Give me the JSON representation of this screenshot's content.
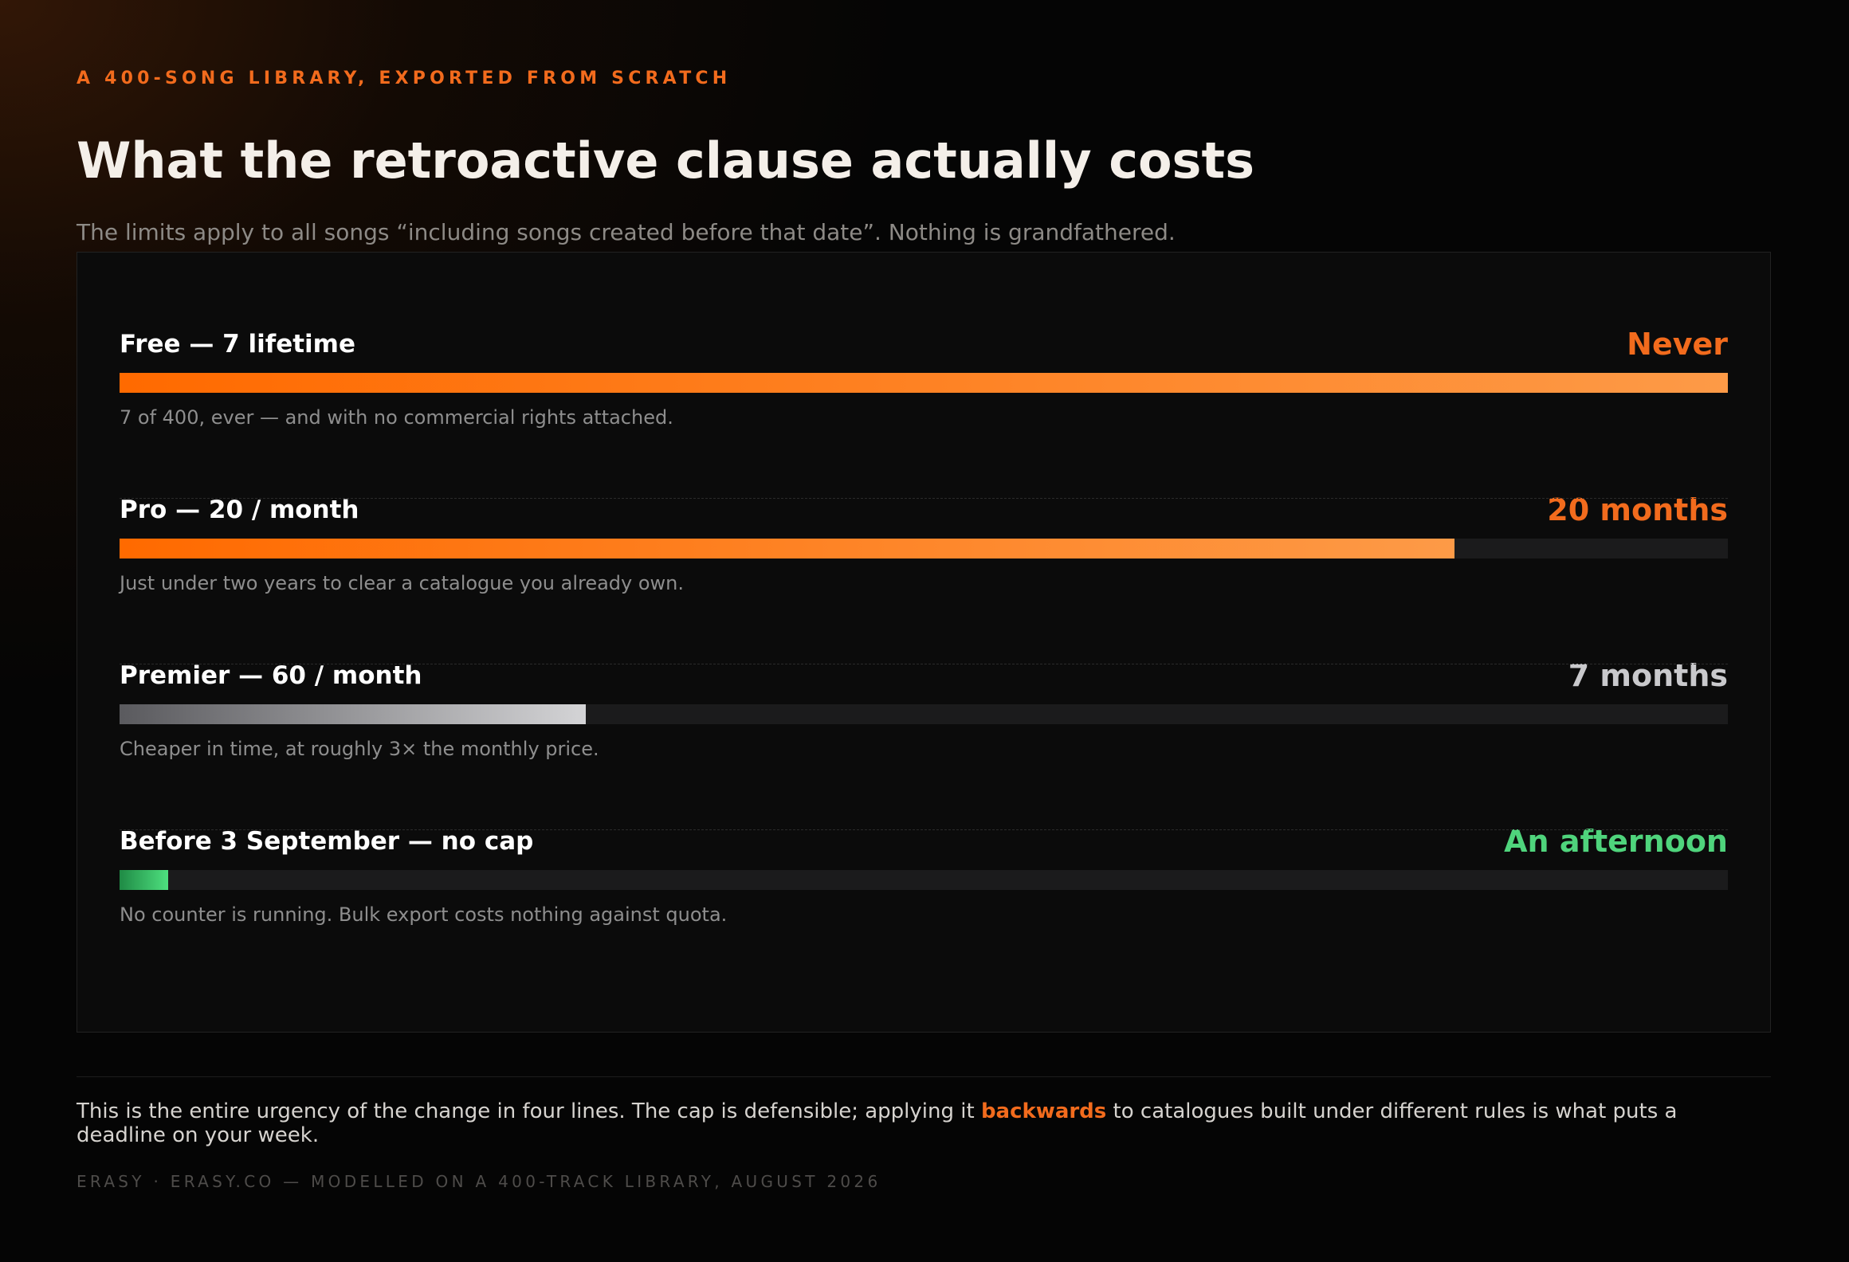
{
  "header": {
    "eyebrow": "A 400-SONG LIBRARY, EXPORTED FROM SCRATCH",
    "title": "What the retroactive clause actually costs",
    "subtitle": "The limits apply to all songs “including songs created before that date”. Nothing is grandfathered."
  },
  "chart_data": {
    "type": "bar",
    "orientation": "horizontal",
    "categories": [
      "Free — 7 lifetime",
      "Pro — 20 / month",
      "Premier — 60 / month",
      "Before 3 September — no cap"
    ],
    "values": [
      1.0,
      0.83,
      0.29,
      0.03
    ],
    "value_labels": [
      "Never",
      "20 months",
      "7 months",
      "An afternoon"
    ],
    "notes": [
      "7 of 400, ever — and with no commercial rights attached.",
      "Just under two years to clear a catalogue you already own.",
      "Cheaper in time, at roughly 3× the monthly price.",
      "No counter is running. Bulk export costs nothing against quota."
    ],
    "colors": [
      {
        "fill_start": "#ff6a00",
        "fill_end": "#fd9a47",
        "label": "#f26b1d"
      },
      {
        "fill_start": "#ff6a00",
        "fill_end": "#fd9a47",
        "label": "#f26b1d"
      },
      {
        "fill_start": "#5a5a5e",
        "fill_end": "#d4d4d6",
        "label": "#c9c9cc"
      },
      {
        "fill_start": "#1f8a45",
        "fill_end": "#4ee07f",
        "label": "#4fd47c"
      }
    ],
    "track_color": "#1b1b1c",
    "grid": false,
    "legend": "none"
  },
  "footer": {
    "text_before": "This is the entire urgency of the change in four lines. The cap is defensible; applying it ",
    "text_accent": "backwards",
    "text_after": " to catalogues built under different rules is what puts a deadline on your week.",
    "credit": "ERASY · ERASY.CO — MODELLED ON A 400-TRACK LIBRARY, AUGUST 2026"
  }
}
